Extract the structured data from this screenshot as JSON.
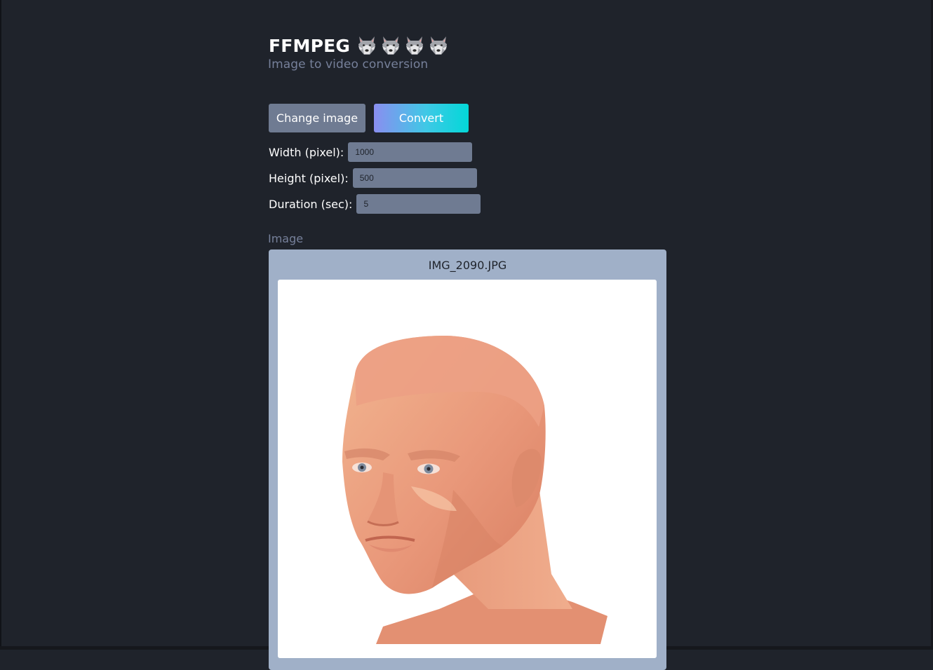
{
  "header": {
    "title": "FFMPEG",
    "subtitle": "Image to video conversion",
    "emoji_icons": [
      "wolf-icon",
      "wolf-icon",
      "wolf-icon",
      "wolf-icon"
    ]
  },
  "actions": {
    "change_image_label": "Change image",
    "convert_label": "Convert"
  },
  "fields": {
    "width": {
      "label": "Width (pixel):",
      "value": "1000"
    },
    "height": {
      "label": "Height (pixel):",
      "value": "500"
    },
    "duration": {
      "label": "Duration (sec):",
      "value": "5"
    }
  },
  "image_section": {
    "label": "Image",
    "file_name": "IMG_2090.JPG"
  },
  "colors": {
    "background": "#1f232b",
    "button_gray": "#6f7b92",
    "convert_gradient_start": "#8a8ef0",
    "convert_gradient_end": "#03d8d8",
    "card": "#a0b0c8",
    "muted_text": "#76809a"
  }
}
